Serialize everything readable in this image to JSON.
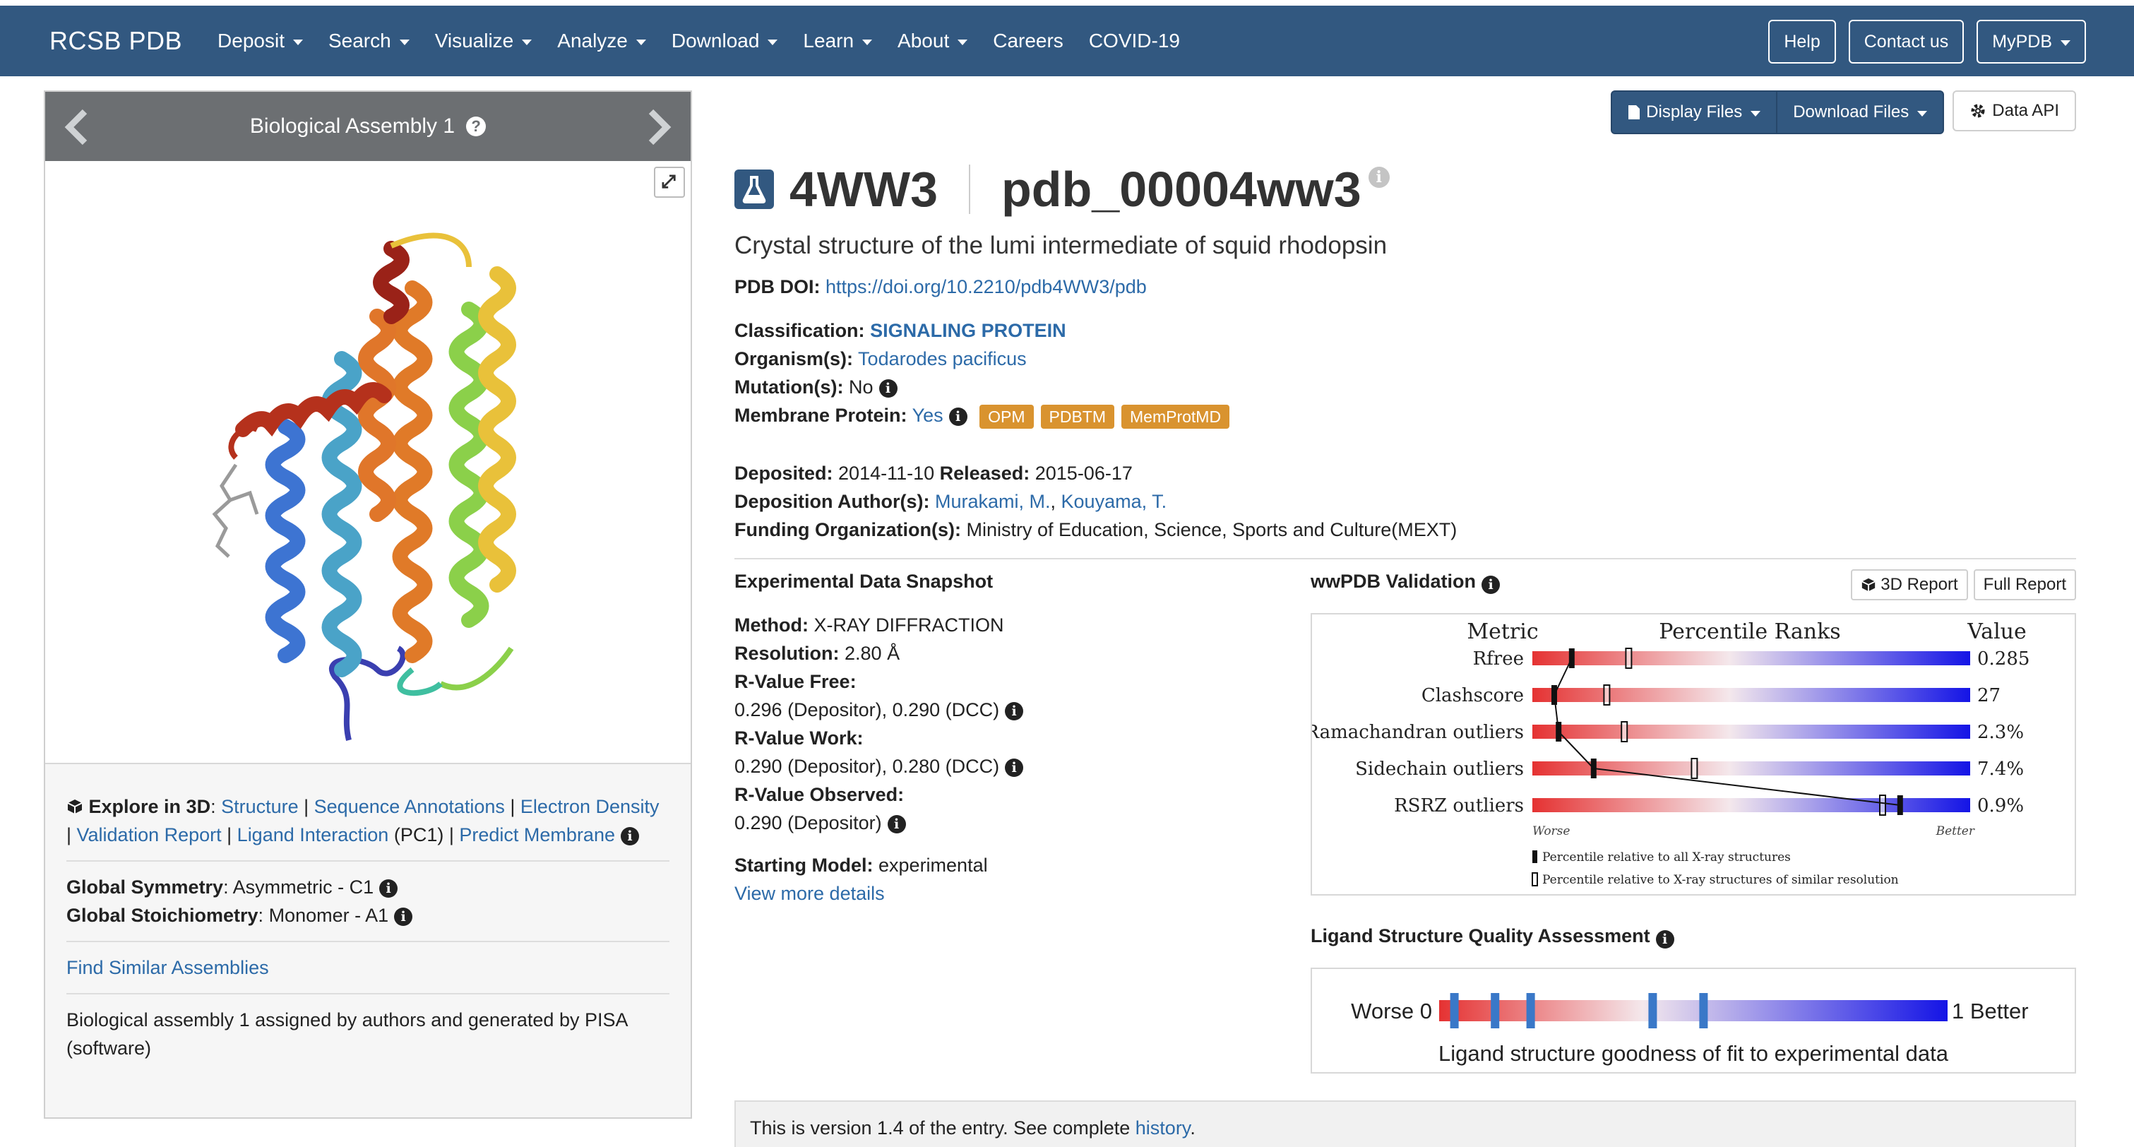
{
  "nav": {
    "brand": "RCSB PDB",
    "items": [
      {
        "label": "Deposit",
        "dropdown": true
      },
      {
        "label": "Search",
        "dropdown": true
      },
      {
        "label": "Visualize",
        "dropdown": true
      },
      {
        "label": "Analyze",
        "dropdown": true
      },
      {
        "label": "Download",
        "dropdown": true
      },
      {
        "label": "Learn",
        "dropdown": true
      },
      {
        "label": "About",
        "dropdown": true
      },
      {
        "label": "Careers",
        "dropdown": false
      },
      {
        "label": "COVID-19",
        "dropdown": false
      }
    ],
    "help": "Help",
    "contact": "Contact us",
    "mypdb": "MyPDB"
  },
  "viewer": {
    "title": "Biological Assembly 1",
    "help_icon": "question-circle-icon"
  },
  "left": {
    "explore_label": "Explore in 3D",
    "explore_links": [
      "Structure",
      "Sequence Annotations",
      "Electron Density",
      "Validation Report",
      "Ligand Interaction"
    ],
    "ligand_suffix": "(PC1)",
    "predict_membrane": "Predict Membrane",
    "global_symmetry_label": "Global Symmetry",
    "global_symmetry_value": "Asymmetric - C1",
    "global_stoich_label": "Global Stoichiometry",
    "global_stoich_value": "Monomer - A1",
    "find_similar": "Find Similar Assemblies",
    "assembly_note": "Biological assembly 1 assigned by authors and generated by PISA (software)"
  },
  "toolbar": {
    "display_files": "Display Files",
    "download_files": "Download Files",
    "data_api": "Data API"
  },
  "entry": {
    "id": "4WW3",
    "ext_id": "pdb_00004ww3",
    "title": "Crystal structure of the lumi intermediate of squid rhodopsin",
    "doi_label": "PDB DOI:",
    "doi": "https://doi.org/10.2210/pdb4WW3/pdb",
    "classification_label": "Classification:",
    "classification": "SIGNALING PROTEIN",
    "organism_label": "Organism(s):",
    "organism": "Todarodes pacificus",
    "mutation_label": "Mutation(s):",
    "mutation": "No",
    "membrane_label": "Membrane Protein:",
    "membrane": "Yes",
    "membrane_tags": [
      "OPM",
      "PDBTM",
      "MemProtMD"
    ],
    "deposited_label": "Deposited:",
    "deposited": "2014-11-10",
    "released_label": "Released:",
    "released": "2015-06-17",
    "authors_label": "Deposition Author(s):",
    "authors": [
      "Murakami, M.",
      "Kouyama, T."
    ],
    "funding_label": "Funding Organization(s):",
    "funding": "Ministry of Education, Science, Sports and Culture(MEXT)"
  },
  "snapshot": {
    "title": "Experimental Data Snapshot",
    "method_label": "Method:",
    "method": "X-RAY DIFFRACTION",
    "resolution_label": "Resolution:",
    "resolution": "2.80 Å",
    "rfree_label": "R-Value Free:",
    "rfree": "0.296 (Depositor), 0.290 (DCC)",
    "rwork_label": "R-Value Work:",
    "rwork": "0.290 (Depositor), 0.280 (DCC)",
    "robs_label": "R-Value Observed:",
    "robs": "0.290 (Depositor)",
    "starting_label": "Starting Model:",
    "starting": "experimental",
    "more": "View more details"
  },
  "validation": {
    "title": "wwPDB Validation",
    "btn_3d": "3D Report",
    "btn_full": "Full Report",
    "col_metric": "Metric",
    "col_ranks": "Percentile Ranks",
    "col_value": "Value",
    "worse": "Worse",
    "better": "Better",
    "legend_all": "Percentile relative to all X-ray structures",
    "legend_similar": "Percentile relative to X-ray structures of similar resolution",
    "metrics": [
      {
        "name": "Rfree",
        "value": "0.285",
        "all": 0.09,
        "similar": 0.22
      },
      {
        "name": "Clashscore",
        "value": "27",
        "all": 0.05,
        "similar": 0.17
      },
      {
        "name": "Ramachandran outliers",
        "value": "2.3%",
        "all": 0.06,
        "similar": 0.21
      },
      {
        "name": "Sidechain outliers",
        "value": "7.4%",
        "all": 0.14,
        "similar": 0.37
      },
      {
        "name": "RSRZ outliers",
        "value": "0.9%",
        "all": 0.84,
        "similar": 0.8
      }
    ]
  },
  "ligand": {
    "title": "Ligand Structure Quality Assessment",
    "worse_label": "Worse 0",
    "better_label": "1 Better",
    "caption": "Ligand structure goodness of fit to experimental data",
    "markers": [
      0.03,
      0.11,
      0.18,
      0.42,
      0.52
    ]
  },
  "version": {
    "text": "This is version 1.4 of the entry. See complete",
    "link": "history",
    "period": "."
  },
  "colors": {
    "navbar": "#325880",
    "link": "#2c6aa8",
    "tag": "#d9932f",
    "worse": "#e53232",
    "better": "#1414e6"
  }
}
